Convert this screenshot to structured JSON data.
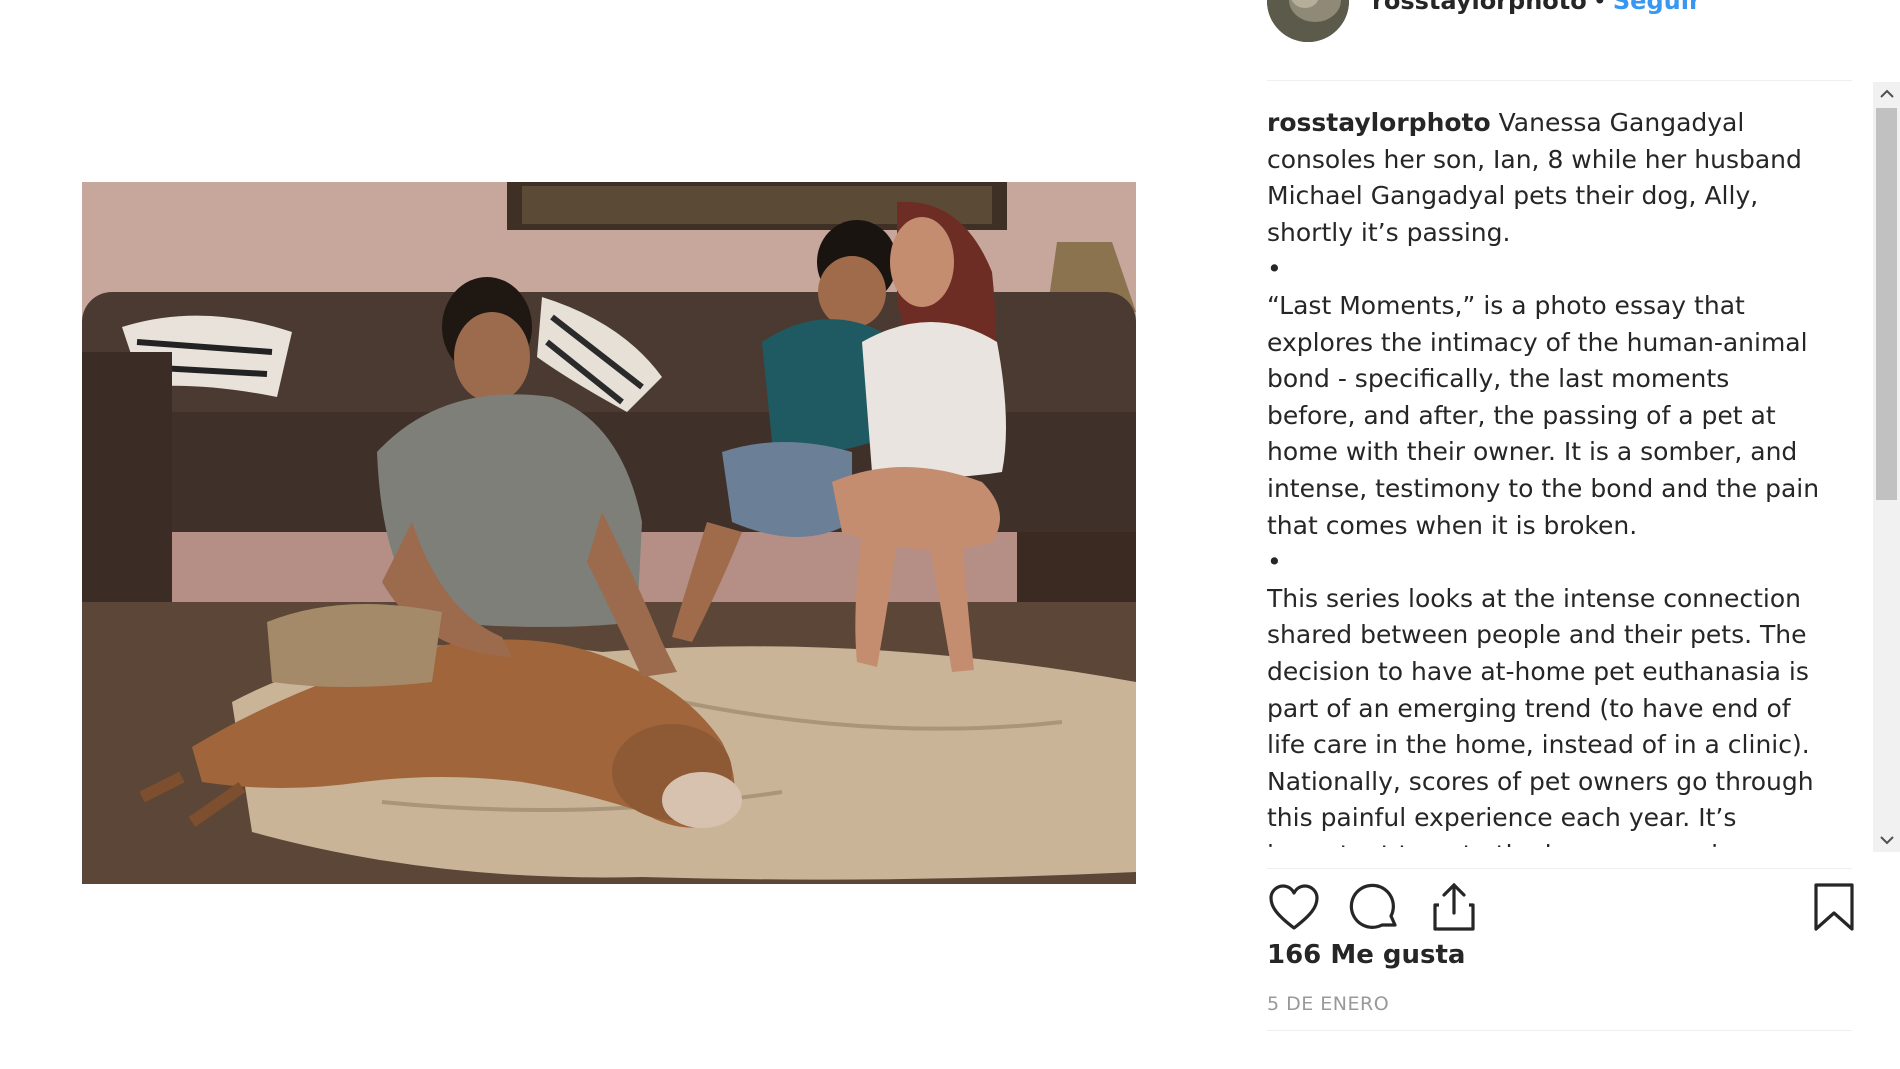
{
  "post": {
    "username": "rosstaylorphoto",
    "separator": "•",
    "follow_label": "Seguir",
    "caption": {
      "author": "rosstaylorphoto",
      "intro": "Vanessa Gangadyal consoles her son, Ian, 8 while her husband Michael Gangadyal pets their dog, Ally, shortly it’s passing.",
      "bullet1": "•",
      "paragraph2": "“Last Moments,” is a photo essay that explores the intimacy of the human-animal bond - specifically, the last moments before, and after, the passing of a pet at home with their owner. It is a somber, and intense, testimony to the bond and the pain that comes when it is broken.",
      "bullet2": "•",
      "paragraph3": "This series looks at the intense connection shared between people and their pets. The decision to have at-home pet euthanasia is part of an emerging trend (to have end of life care in the home, instead of in a clinic). Nationally, scores of pet owners go through this painful experience each year. It’s important to note the human experience and"
    },
    "likes": "166 Me gusta",
    "date": "5 DE ENERO"
  },
  "icons": {
    "like": "heart-icon",
    "comment": "comment-icon",
    "share": "share-icon",
    "save": "bookmark-icon",
    "scroll_up": "chevron-up-icon",
    "scroll_down": "chevron-down-icon"
  },
  "colors": {
    "link": "#3897f0",
    "text": "#262626",
    "muted": "#999999",
    "divider": "#efefef"
  }
}
